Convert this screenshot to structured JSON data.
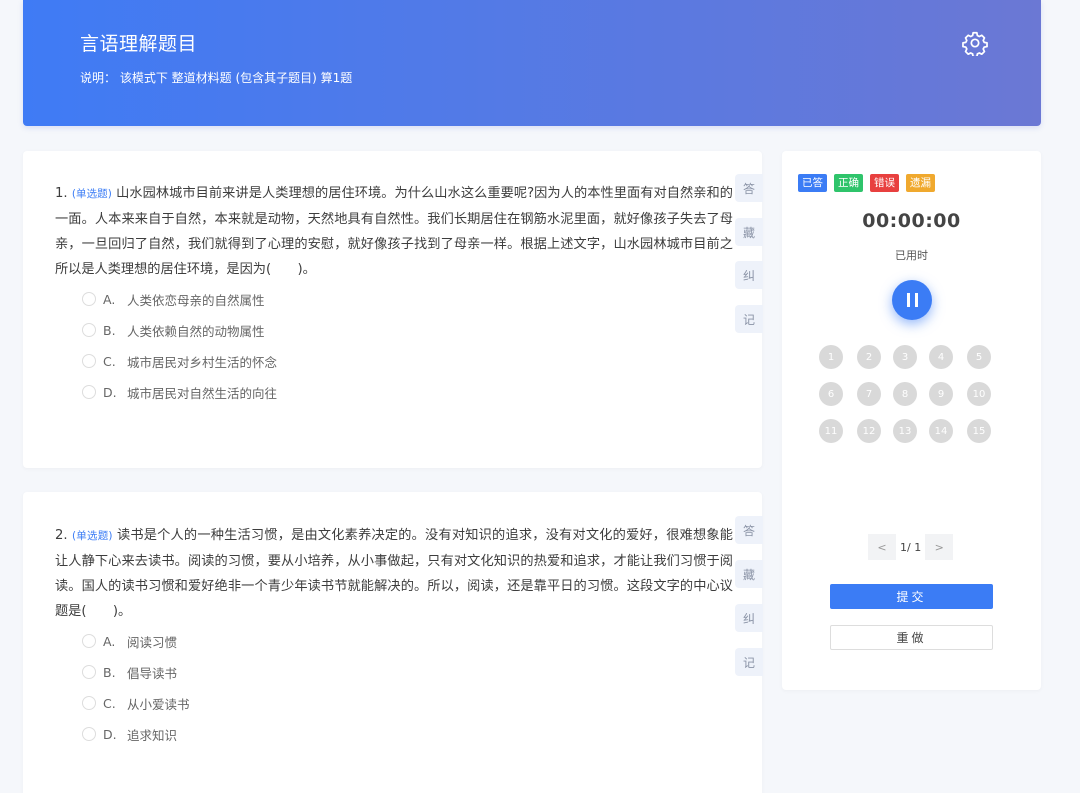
{
  "header": {
    "title": "言语理解题目",
    "description": "说明： 该模式下 整道材料题 (包含其子题目) 算1题",
    "settings_icon": "gear-icon"
  },
  "questions": [
    {
      "number": "1.",
      "type": "(单选题)",
      "text": "山水园林城市目前来讲是人类理想的居住环境。为什么山水这么重要呢?因为人的本性里面有对自然亲和的一面。人本来来自于自然，本来就是动物，天然地具有自然性。我们长期居住在钢筋水泥里面，就好像孩子失去了母亲，一旦回归了自然，我们就得到了心理的安慰，就好像孩子找到了母亲一样。根据上述文字，山水园林城市目前之所以是人类理想的居住环境，是因为(　　)。",
      "options": [
        {
          "letter": "A.",
          "text": "人类依恋母亲的自然属性"
        },
        {
          "letter": "B.",
          "text": "人类依赖自然的动物属性"
        },
        {
          "letter": "C.",
          "text": "城市居民对乡村生活的怀念"
        },
        {
          "letter": "D.",
          "text": "城市居民对自然生活的向往"
        }
      ],
      "tabs": [
        "答",
        "藏",
        "纠",
        "记"
      ]
    },
    {
      "number": "2.",
      "type": "(单选题)",
      "text": "读书是个人的一种生活习惯，是由文化素养决定的。没有对知识的追求，没有对文化的爱好，很难想象能让人静下心来去读书。阅读的习惯，要从小培养，从小事做起，只有对文化知识的热爱和追求，才能让我们习惯于阅读。国人的读书习惯和爱好绝非一个青少年读书节就能解决的。所以，阅读，还是靠平日的习惯。这段文字的中心议题是(　　)。",
      "options": [
        {
          "letter": "A.",
          "text": "阅读习惯"
        },
        {
          "letter": "B.",
          "text": "倡导读书"
        },
        {
          "letter": "C.",
          "text": "从小爱读书"
        },
        {
          "letter": "D.",
          "text": "追求知识"
        }
      ],
      "tabs": [
        "答",
        "藏",
        "纠",
        "记"
      ]
    }
  ],
  "panel": {
    "legend": [
      {
        "label": "已答",
        "color": "#3b7cf5"
      },
      {
        "label": "正确",
        "color": "#2fc46b"
      },
      {
        "label": "错误",
        "color": "#e8403f"
      },
      {
        "label": "遗漏",
        "color": "#f0a92e"
      }
    ],
    "timer": "00:00:00",
    "timer_label": "已用时",
    "pause_icon": "pause-icon",
    "numbers": [
      "1",
      "2",
      "3",
      "4",
      "5",
      "6",
      "7",
      "8",
      "9",
      "10",
      "11",
      "12",
      "13",
      "14",
      "15"
    ],
    "pager": {
      "prev": "<",
      "text": "1/ 1",
      "next": ">"
    },
    "submit_label": "提交",
    "redo_label": "重做"
  }
}
